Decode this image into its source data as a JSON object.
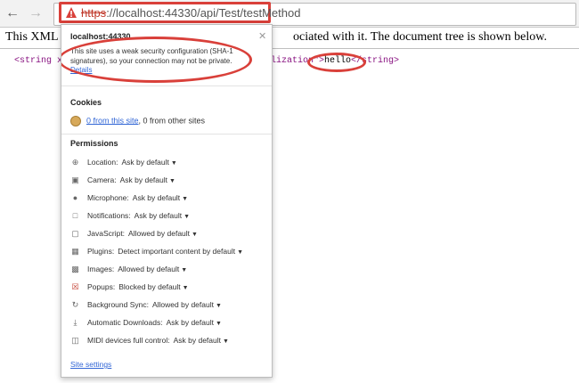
{
  "browser": {
    "back_icon": "arrow-left-icon",
    "forward_icon": "arrow-right-icon",
    "url_scheme": "https",
    "url_rest": "://localhost:44330/api/Test/testMethod",
    "warning_icon": "warning-triangle-icon",
    "accent_color": "#d9403a"
  },
  "page": {
    "xml_info_left": "This XML fi",
    "xml_info_right": "ociated with it. The document tree is shown below.",
    "xml_open_left": "<string xm",
    "xml_open_right": "lization\"",
    "xml_tag_close": ">",
    "xml_text": "hello",
    "xml_close": "</string>"
  },
  "popup": {
    "host": "localhost:44330",
    "close_icon": "close-icon",
    "message": "This site uses a weak security configuration (SHA-1 signatures), so your connection may not be private.",
    "details_link": "Details",
    "cookies_title": "Cookies",
    "cookies_link": "0 from this site",
    "cookies_rest": ", 0 from other sites",
    "permissions_title": "Permissions",
    "permissions": [
      {
        "label": "Location:",
        "value": "Ask by default",
        "icon": "location-icon"
      },
      {
        "label": "Camera:",
        "value": "Ask by default",
        "icon": "camera-icon"
      },
      {
        "label": "Microphone:",
        "value": "Ask by default",
        "icon": "microphone-icon"
      },
      {
        "label": "Notifications:",
        "value": "Ask by default",
        "icon": "notifications-icon"
      },
      {
        "label": "JavaScript:",
        "value": "Allowed by default",
        "icon": "javascript-icon"
      },
      {
        "label": "Plugins:",
        "value": "Detect important content by default",
        "icon": "plugins-icon"
      },
      {
        "label": "Images:",
        "value": "Allowed by default",
        "icon": "images-icon"
      },
      {
        "label": "Popups:",
        "value": "Blocked by default",
        "icon": "popups-icon"
      },
      {
        "label": "Background Sync:",
        "value": "Allowed by default",
        "icon": "background-sync-icon"
      },
      {
        "label": "Automatic Downloads:",
        "value": "Ask by default",
        "icon": "download-icon"
      },
      {
        "label": "MIDI devices full control:",
        "value": "Ask by default",
        "icon": "midi-icon"
      }
    ],
    "site_settings_link": "Site settings"
  }
}
